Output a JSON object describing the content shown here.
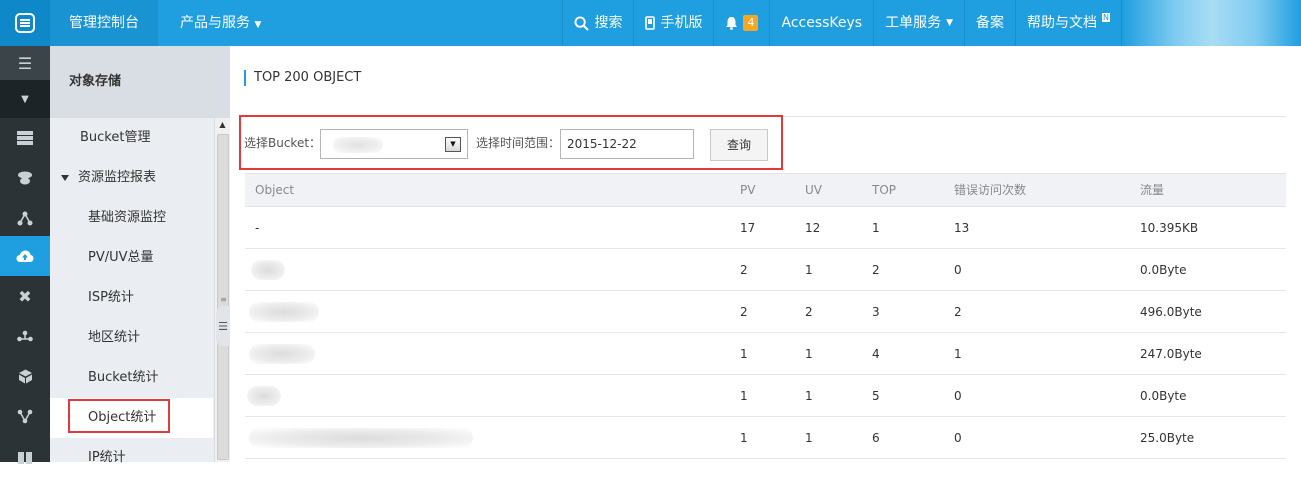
{
  "topbar": {
    "home": "管理控制台",
    "products": "产品与服务",
    "search": "搜索",
    "mobile": "手机版",
    "notify_count": "4",
    "access_keys": "AccessKeys",
    "tickets": "工单服务",
    "beian": "备案",
    "help": "帮助与文档",
    "help_badge": "N"
  },
  "sidebar": {
    "title": "对象存储",
    "items": [
      {
        "label": "Bucket管理"
      },
      {
        "label": "资源监控报表"
      },
      {
        "label": "基础资源监控"
      },
      {
        "label": "PV/UV总量"
      },
      {
        "label": "ISP统计"
      },
      {
        "label": "地区统计"
      },
      {
        "label": "Bucket统计"
      },
      {
        "label": "Object统计"
      },
      {
        "label": "IP统计"
      }
    ]
  },
  "main": {
    "title": "TOP 200 OBJECT",
    "filter": {
      "bucket_label": "选择Bucket：",
      "time_label": "选择时间范围：",
      "date_value": "2015-12-22",
      "query_button": "查询"
    },
    "table": {
      "columns": [
        "Object",
        "PV",
        "UV",
        "TOP",
        "错误访问次数",
        "流量"
      ],
      "rows": [
        {
          "object": "-",
          "pv": "17",
          "uv": "12",
          "top": "1",
          "errors": "13",
          "traffic": "10.395KB"
        },
        {
          "object": "",
          "pv": "2",
          "uv": "1",
          "top": "2",
          "errors": "0",
          "traffic": "0.0Byte"
        },
        {
          "object": "",
          "pv": "2",
          "uv": "2",
          "top": "3",
          "errors": "2",
          "traffic": "496.0Byte"
        },
        {
          "object": "",
          "pv": "1",
          "uv": "1",
          "top": "4",
          "errors": "1",
          "traffic": "247.0Byte"
        },
        {
          "object": "",
          "pv": "1",
          "uv": "1",
          "top": "5",
          "errors": "0",
          "traffic": "0.0Byte"
        },
        {
          "object": "",
          "pv": "1",
          "uv": "1",
          "top": "6",
          "errors": "0",
          "traffic": "25.0Byte"
        }
      ]
    }
  },
  "colors": {
    "topbar": "#1f9ee0",
    "rail": "#2b3337",
    "highlight": "#e03a3a"
  }
}
